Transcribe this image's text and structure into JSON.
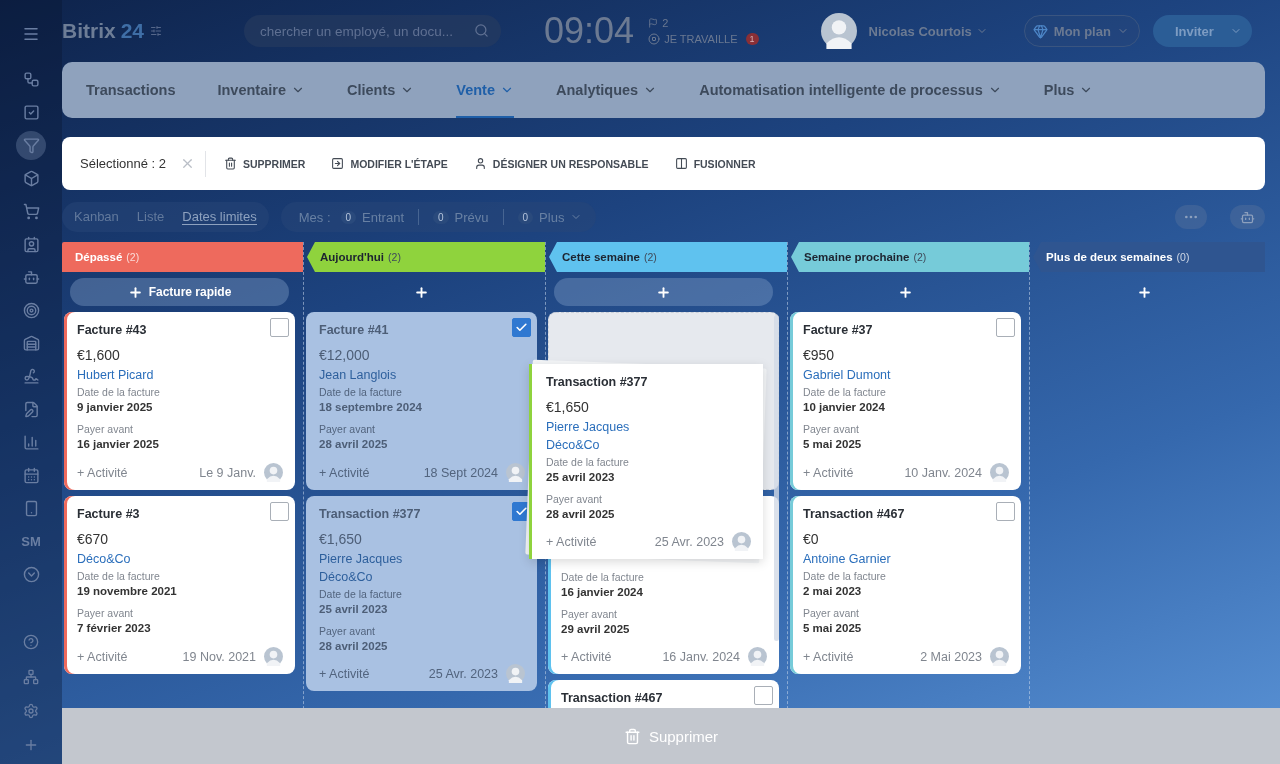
{
  "topbar": {
    "logo": "Bitrix",
    "logo_suffix": "24",
    "search": {
      "placeholder": "chercher un employé, un docu..."
    },
    "clock": "09:04",
    "flag_count": "2",
    "status": "JE TRAVAILLE",
    "status_badge": "1",
    "user": "Nicolas Courtois",
    "plan": "Mon plan",
    "invite": "Inviter"
  },
  "sidebar": {
    "items": [
      {
        "selected": false
      },
      {
        "selected": false
      },
      {
        "selected": true
      },
      {
        "selected": false
      },
      {
        "selected": false
      },
      {
        "selected": false
      },
      {
        "selected": false
      },
      {
        "selected": false
      },
      {
        "selected": false
      },
      {
        "selected": false
      },
      {
        "selected": false
      },
      {
        "selected": false
      },
      {
        "selected": false
      },
      {
        "selected": false
      },
      {
        "kind": "text",
        "label": "SM",
        "selected": false
      },
      {
        "selected": false
      }
    ],
    "footer_items": [
      {
        "selected": false
      },
      {
        "selected": false
      },
      {
        "selected": false
      },
      {
        "selected": false
      }
    ]
  },
  "nav": [
    {
      "label": "Transactions",
      "selected": false
    },
    {
      "label": "Inventaire",
      "dropdown": true,
      "selected": false
    },
    {
      "label": "Clients",
      "dropdown": true,
      "selected": false
    },
    {
      "label": "Vente",
      "dropdown": true,
      "selected": true
    },
    {
      "label": "Analytiques",
      "dropdown": true,
      "selected": false
    },
    {
      "label": "Automatisation intelligente de processus",
      "dropdown": true,
      "selected": false
    },
    {
      "label": "Plus",
      "dropdown": true,
      "selected": false
    }
  ],
  "selection_bar": {
    "label": "Sélectionné : 2",
    "actions": [
      {
        "kind": "delete",
        "label": "SUPPRIMER"
      },
      {
        "kind": "stage",
        "label": "MODIFIER L'ÉTAPE"
      },
      {
        "kind": "assign",
        "label": "DÉSIGNER UN RESPONSABLE"
      },
      {
        "kind": "merge",
        "label": "FUSIONNER"
      }
    ]
  },
  "view_tabs": [
    {
      "label": "Kanban",
      "selected": false
    },
    {
      "label": "Liste",
      "selected": false
    },
    {
      "label": "Dates limites",
      "selected": true
    }
  ],
  "counters": {
    "label": "Mes :",
    "items": [
      {
        "count": "0",
        "label": "Entrant"
      },
      {
        "count": "0",
        "label": "Prévu"
      },
      {
        "count": "0",
        "label": "Plus",
        "dropdown": true
      }
    ]
  },
  "columns": [
    {
      "title": "Dépassé",
      "count": "(2)",
      "color": "#ee6a5d",
      "add": {
        "kind": "pill",
        "label": "Facture rapide"
      },
      "cards": [
        {
          "kind": "card",
          "title": "Facture #43",
          "amount": "€1,600",
          "contacts": [
            "Hubert Picard"
          ],
          "invoice_label": "Date de la facture",
          "invoice_date": "9 janvier 2025",
          "pay_label": "Payer avant",
          "pay_date": "16 janvier 2025",
          "activity": "+ Activité",
          "date": "Le 9 Janv.",
          "checked": false
        },
        {
          "kind": "card",
          "title": "Facture #3",
          "amount": "€670",
          "contacts": [
            "Déco&Co"
          ],
          "invoice_label": "Date de la facture",
          "invoice_date": "19 novembre 2021",
          "pay_label": "Payer avant",
          "pay_date": "7 février 2023",
          "activity": "+ Activité",
          "date": "19 Nov. 2021",
          "checked": false
        }
      ]
    },
    {
      "title": "Aujourd'hui",
      "count": "(2)",
      "color": "#8fd33d",
      "add": {
        "kind": "plain"
      },
      "cards": [
        {
          "kind": "card",
          "title": "Facture #41",
          "amount": "€12,000",
          "contacts": [
            "Jean Langlois"
          ],
          "invoice_label": "Date de la facture",
          "invoice_date": "18 septembre 2024",
          "pay_label": "Payer avant",
          "pay_date": "28 avril 2025",
          "activity": "+ Activité",
          "date": "18 Sept 2024",
          "checked": true
        },
        {
          "kind": "card",
          "title": "Transaction #377",
          "amount": "€1,650",
          "contacts": [
            "Pierre Jacques",
            "Déco&Co"
          ],
          "invoice_label": "Date de la facture",
          "invoice_date": "25 avril 2023",
          "pay_label": "Payer avant",
          "pay_date": "28 avril 2025",
          "activity": "+ Activité",
          "date": "25 Avr. 2023",
          "checked": true
        }
      ]
    },
    {
      "title": "Cette semaine",
      "count": "(2)",
      "color": "#5fc2ef",
      "add": {
        "kind": "pill"
      },
      "cards": [
        {
          "kind": "placeholder"
        },
        {
          "kind": "covered",
          "invoice_label": "Date de la facture",
          "invoice_date": "16 janvier 2024",
          "pay_label": "Payer avant",
          "pay_date": "29 avril 2025",
          "activity": "+ Activité",
          "date": "16 Janv. 2024"
        },
        {
          "kind": "card",
          "title": "Transaction #467",
          "checked": false
        }
      ]
    },
    {
      "title": "Semaine prochaine",
      "count": "(2)",
      "color": "#76cbd9",
      "add": {
        "kind": "plain"
      },
      "cards": [
        {
          "kind": "card",
          "title": "Facture #37",
          "amount": "€950",
          "contacts": [
            "Gabriel Dumont"
          ],
          "invoice_label": "Date de la facture",
          "invoice_date": "10 janvier 2024",
          "pay_label": "Payer avant",
          "pay_date": "5 mai 2025",
          "activity": "+ Activité",
          "date": "10 Janv. 2024",
          "checked": false
        },
        {
          "kind": "card",
          "title": "Transaction #467",
          "amount": "€0",
          "contacts": [
            "Antoine Garnier"
          ],
          "invoice_label": "Date de la facture",
          "invoice_date": "2 mai 2023",
          "pay_label": "Payer avant",
          "pay_date": "5 mai 2025",
          "activity": "+ Activité",
          "date": "2 Mai 2023",
          "checked": false
        }
      ]
    },
    {
      "title": "Plus de deux semaines",
      "count": "(0)",
      "color": "#2f5590",
      "add": {
        "kind": "plain"
      }
    }
  ],
  "drag_card": {
    "color": "#8fd33d",
    "title": "Transaction #377",
    "amount": "€1,650",
    "contacts": [
      "Pierre Jacques",
      "Déco&Co"
    ],
    "invoice_label": "Date de la facture",
    "invoice_date": "25 avril 2023",
    "pay_label": "Payer avant",
    "pay_date": "28 avril 2025",
    "activity": "+ Activité",
    "date": "25 Avr. 2023"
  },
  "drop_zone": {
    "label": "Supprimer"
  }
}
